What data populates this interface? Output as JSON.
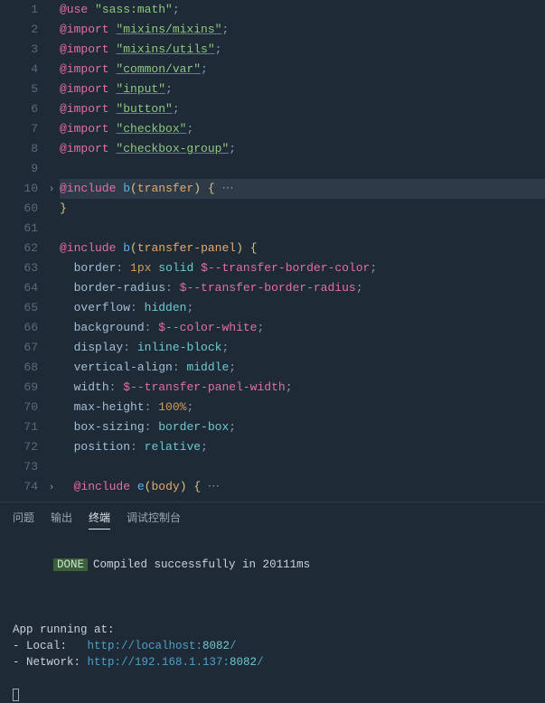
{
  "editor": {
    "lines": [
      {
        "n": 1,
        "fold": "",
        "html": "<span class='kw'>@use</span> <span class='str'>\"sass:math\"</span><span class='punc'>;</span>"
      },
      {
        "n": 2,
        "fold": "",
        "html": "<span class='kw'>@import</span> <span class='str u'>\"mixins/mixins\"</span><span class='punc'>;</span>"
      },
      {
        "n": 3,
        "fold": "",
        "html": "<span class='kw'>@import</span> <span class='str u'>\"mixins/utils\"</span><span class='punc'>;</span>"
      },
      {
        "n": 4,
        "fold": "",
        "html": "<span class='kw'>@import</span> <span class='str u'>\"common/var\"</span><span class='punc'>;</span>"
      },
      {
        "n": 5,
        "fold": "",
        "html": "<span class='kw'>@import</span> <span class='str u'>\"input\"</span><span class='punc'>;</span>"
      },
      {
        "n": 6,
        "fold": "",
        "html": "<span class='kw'>@import</span> <span class='str u'>\"button\"</span><span class='punc'>;</span>"
      },
      {
        "n": 7,
        "fold": "",
        "html": "<span class='kw'>@import</span> <span class='str u'>\"checkbox\"</span><span class='punc'>;</span>"
      },
      {
        "n": 8,
        "fold": "",
        "html": "<span class='kw'>@import</span> <span class='str u'>\"checkbox-group\"</span><span class='punc'>;</span>"
      },
      {
        "n": 9,
        "fold": "",
        "html": ""
      },
      {
        "n": 10,
        "fold": ">",
        "hl": true,
        "html": "<span class='kw'>@include</span> <span class='fn'>b</span><span class='brace'>(</span><span class='ident'>transfer</span><span class='brace'>)</span> <span class='brace'>{</span><span class='ellips'> ⋯</span>"
      },
      {
        "n": 60,
        "fold": "",
        "html": "<span class='brace'>}</span>"
      },
      {
        "n": 61,
        "fold": "",
        "html": ""
      },
      {
        "n": 62,
        "fold": "",
        "html": "<span class='kw'>@include</span> <span class='fn'>b</span><span class='brace'>(</span><span class='ident'>transfer-panel</span><span class='brace'>)</span> <span class='brace'>{</span>"
      },
      {
        "n": 63,
        "fold": "",
        "html": "  <span class='prop'>border</span><span class='punc'>:</span> <span class='num'>1px</span> <span class='val'>solid</span> <span class='var'>$--transfer-border-color</span><span class='punc'>;</span>"
      },
      {
        "n": 64,
        "fold": "",
        "html": "  <span class='prop'>border-radius</span><span class='punc'>:</span> <span class='var'>$--transfer-border-radius</span><span class='punc'>;</span>"
      },
      {
        "n": 65,
        "fold": "",
        "html": "  <span class='prop'>overflow</span><span class='punc'>:</span> <span class='val'>hidden</span><span class='punc'>;</span>"
      },
      {
        "n": 66,
        "fold": "",
        "html": "  <span class='prop'>background</span><span class='punc'>:</span> <span class='var'>$--color-white</span><span class='punc'>;</span>"
      },
      {
        "n": 67,
        "fold": "",
        "html": "  <span class='prop'>display</span><span class='punc'>:</span> <span class='val'>inline-block</span><span class='punc'>;</span>"
      },
      {
        "n": 68,
        "fold": "",
        "html": "  <span class='prop'>vertical-align</span><span class='punc'>:</span> <span class='val'>middle</span><span class='punc'>;</span>"
      },
      {
        "n": 69,
        "fold": "",
        "html": "  <span class='prop'>width</span><span class='punc'>:</span> <span class='var'>$--transfer-panel-width</span><span class='punc'>;</span>"
      },
      {
        "n": 70,
        "fold": "",
        "html": "  <span class='prop'>max-height</span><span class='punc'>:</span> <span class='num'>100%</span><span class='punc'>;</span>"
      },
      {
        "n": 71,
        "fold": "",
        "html": "  <span class='prop'>box-sizing</span><span class='punc'>:</span> <span class='val'>border-box</span><span class='punc'>;</span>"
      },
      {
        "n": 72,
        "fold": "",
        "html": "  <span class='prop'>position</span><span class='punc'>:</span> <span class='val'>relative</span><span class='punc'>;</span>"
      },
      {
        "n": 73,
        "fold": "",
        "html": ""
      },
      {
        "n": 74,
        "fold": ">",
        "html": "  <span class='kw'>@include</span> <span class='fn'>e</span><span class='brace'>(</span><span class='ident'>body</span><span class='brace'>)</span> <span class='brace'>{</span><span class='ellips'> ⋯</span>"
      }
    ]
  },
  "panel": {
    "tabs": [
      {
        "id": "problems",
        "label": "问题",
        "active": false
      },
      {
        "id": "output",
        "label": "输出",
        "active": false
      },
      {
        "id": "terminal",
        "label": "终端",
        "active": true
      },
      {
        "id": "debug",
        "label": "调试控制台",
        "active": false
      }
    ],
    "terminal": {
      "done_label": "DONE",
      "done_text": "Compiled successfully in 20111ms",
      "running_label": "App running at:",
      "local_label": "- Local:   ",
      "local_url_prefix": "http://localhost:",
      "local_port": "8082",
      "local_suffix": "/",
      "network_label": "- Network: ",
      "network_url_prefix": "http://192.168.1.137:",
      "network_port": "8082",
      "network_suffix": "/"
    }
  }
}
